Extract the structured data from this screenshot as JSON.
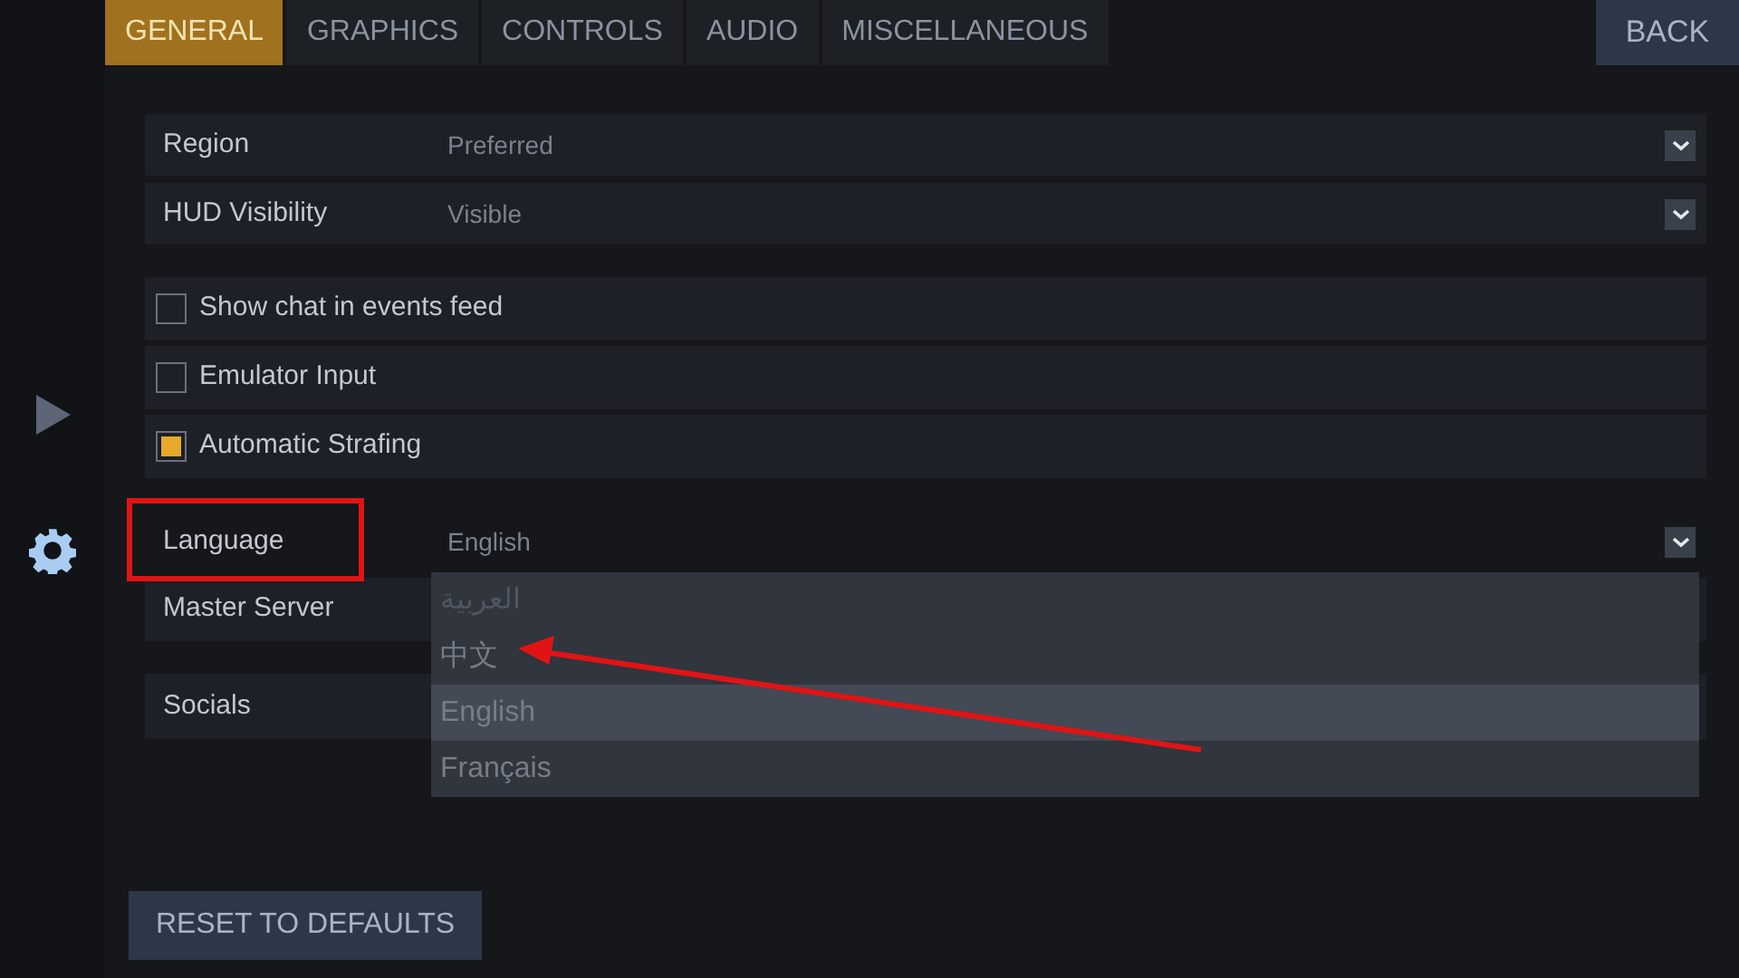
{
  "sidebar": {
    "items": [
      {
        "kind": "play",
        "selected": false
      },
      {
        "kind": "settings",
        "selected": true
      }
    ]
  },
  "tabs": [
    {
      "label": "GENERAL",
      "selected": true
    },
    {
      "label": "GRAPHICS",
      "selected": false
    },
    {
      "label": "CONTROLS",
      "selected": false
    },
    {
      "label": "AUDIO",
      "selected": false
    },
    {
      "label": "MISCELLANEOUS",
      "selected": false
    }
  ],
  "back_button": "BACK",
  "dropdowns": [
    {
      "label": "Region",
      "value": "Preferred"
    },
    {
      "label": "HUD Visibility",
      "value": "Visible"
    }
  ],
  "checkboxes": [
    {
      "label": "Show chat in events feed",
      "checked": false
    },
    {
      "label": "Emulator Input",
      "checked": false
    },
    {
      "label": "Automatic Strafing",
      "checked": true
    }
  ],
  "language": {
    "label": "Language",
    "value": "English",
    "expanded": true,
    "highlighted": true
  },
  "master_server": {
    "label": "Master Server"
  },
  "socials": {
    "label": "Socials"
  },
  "language_menu": {
    "options": [
      {
        "label": "العربية",
        "selected": false,
        "dimmed": true
      },
      {
        "label": "中文",
        "selected": false,
        "dimmed": false
      },
      {
        "label": "English",
        "selected": true,
        "dimmed": false
      },
      {
        "label": "Français",
        "selected": false,
        "dimmed": false
      }
    ]
  },
  "annotation_arrow": true,
  "reset_button": "RESET TO DEFAULTS"
}
